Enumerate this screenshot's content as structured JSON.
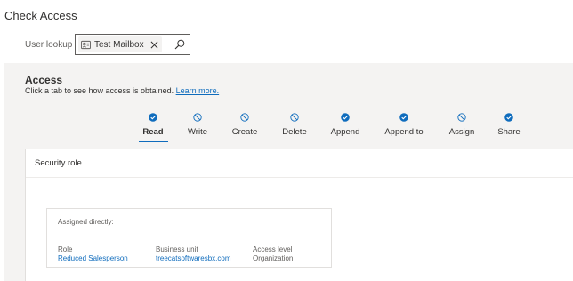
{
  "page": {
    "title": "Check Access"
  },
  "lookup": {
    "label": "User lookup",
    "selected_user": "Test Mailbox",
    "tag_icon": "user-record-icon",
    "remove_icon": "close-icon",
    "search_icon": "search-icon"
  },
  "access": {
    "title": "Access",
    "subtitle": "Click a tab to see how access is obtained.",
    "learn_more": "Learn more.",
    "active_tab": "Read",
    "tabs": [
      {
        "label": "Read",
        "status": "granted",
        "icon": "check-circle-icon"
      },
      {
        "label": "Write",
        "status": "denied",
        "icon": "blocked-circle-icon"
      },
      {
        "label": "Create",
        "status": "denied",
        "icon": "blocked-circle-icon"
      },
      {
        "label": "Delete",
        "status": "denied",
        "icon": "blocked-circle-icon"
      },
      {
        "label": "Append",
        "status": "granted",
        "icon": "check-circle-icon"
      },
      {
        "label": "Append to",
        "status": "granted",
        "icon": "check-circle-icon"
      },
      {
        "label": "Assign",
        "status": "denied",
        "icon": "blocked-circle-icon"
      },
      {
        "label": "Share",
        "status": "granted",
        "icon": "check-circle-icon"
      }
    ]
  },
  "security_role": {
    "header": "Security role",
    "assigned_title": "Assigned directly:",
    "columns": [
      {
        "header": "Role",
        "value": "Reduced Salesperson",
        "is_link": true
      },
      {
        "header": "Business unit",
        "value": "treecatsoftwaresbx.com",
        "is_link": true
      },
      {
        "header": "Access level",
        "value": "Organization",
        "is_link": false
      }
    ]
  },
  "colors": {
    "accent": "#0f6cbd",
    "granted": "#0f6cbd",
    "denied": "#0f6cbd",
    "panel_bg": "#f4f3f2"
  }
}
